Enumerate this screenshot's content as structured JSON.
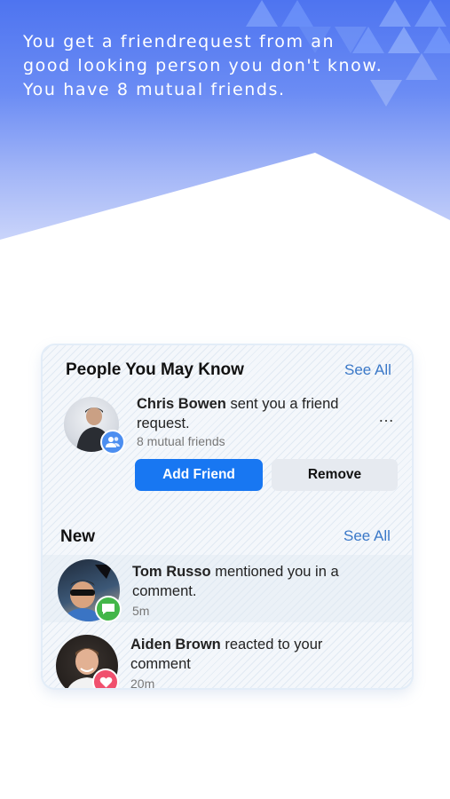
{
  "caption": {
    "line1": "You get a friendrequest from an",
    "line2": "good looking person you don't know.",
    "line3": "You have 8 mutual friends."
  },
  "people_section": {
    "title": "People You May Know",
    "see_all": "See All",
    "request": {
      "name": "Chris Bowen",
      "text_1": " sent you a friend",
      "text_2": "request.",
      "mutual": "8 mutual friends",
      "more": "…",
      "add_label": "Add Friend",
      "remove_label": "Remove",
      "badge_icon": "friend-request-icon"
    }
  },
  "new_section": {
    "title": "New",
    "see_all": "See All",
    "items": [
      {
        "name": "Tom Russo",
        "text_1": " mentioned you in a",
        "text_2": "comment.",
        "time": "5m",
        "badge_icon": "comment-icon",
        "badge_color": "#43b649"
      },
      {
        "name": "Aiden Brown",
        "text_1": " reacted to your",
        "text_2": "comment",
        "time": "20m",
        "badge_icon": "heart-icon",
        "badge_color": "#f0506e"
      }
    ]
  },
  "colors": {
    "accent": "#1877f2",
    "link": "#3a78c8",
    "hero_top": "#4e74f0"
  }
}
